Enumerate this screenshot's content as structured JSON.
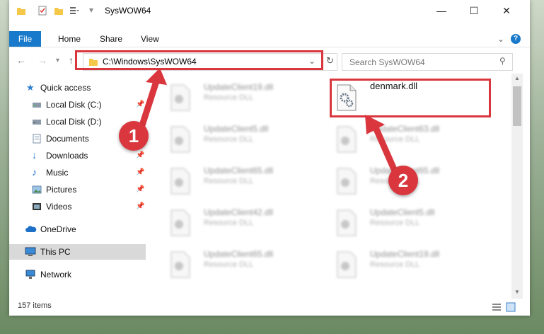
{
  "window": {
    "title": "SysWOW64",
    "minimize_glyph": "—",
    "maximize_glyph": "☐",
    "close_glyph": "✕"
  },
  "ribbon": {
    "file_label": "File",
    "tabs": [
      "Home",
      "Share",
      "View"
    ],
    "expand_glyph": "⌄",
    "help_glyph": "?"
  },
  "address": {
    "path": "C:\\Windows\\SysWOW64",
    "search_placeholder": "Search SysWOW64"
  },
  "nav": {
    "items": [
      {
        "label": "Quick access",
        "icon": "star-icon",
        "pinned": false
      },
      {
        "label": "Local Disk (C:)",
        "icon": "drive-icon",
        "pinned": true
      },
      {
        "label": "Local Disk (D:)",
        "icon": "drive-icon",
        "pinned": false
      },
      {
        "label": "Documents",
        "icon": "documents-icon",
        "pinned": true
      },
      {
        "label": "Downloads",
        "icon": "downloads-icon",
        "pinned": true
      },
      {
        "label": "Music",
        "icon": "music-icon",
        "pinned": true
      },
      {
        "label": "Pictures",
        "icon": "pictures-icon",
        "pinned": true
      },
      {
        "label": "Videos",
        "icon": "videos-icon",
        "pinned": true
      },
      {
        "label": "OneDrive",
        "icon": "cloud-icon",
        "pinned": false
      },
      {
        "label": "This PC",
        "icon": "computer-icon",
        "pinned": false
      },
      {
        "label": "Network",
        "icon": "network-icon",
        "pinned": false
      }
    ]
  },
  "files": {
    "left": [
      {
        "name": "UpdateClient19.dll",
        "type": "Resource DLL"
      },
      {
        "name": "UpdateClient5.dll",
        "type": "Resource DLL"
      },
      {
        "name": "UpdateClient65.dll",
        "type": "Resource DLL"
      },
      {
        "name": "UpdateClient42.dll",
        "type": "Resource DLL"
      },
      {
        "name": "UpdateClient65.dll",
        "type": "Resource DLL"
      }
    ],
    "right": [
      {
        "name": "denmark.dll",
        "type": ""
      },
      {
        "name": "UpdateClient63.dll",
        "type": "Resource DLL"
      },
      {
        "name": "UpdateClient65.dll",
        "type": "Resource DLL"
      },
      {
        "name": "UpdateClient5.dll",
        "type": "Resource DLL"
      },
      {
        "name": "UpdateClient19.dll",
        "type": "Resource DLL"
      }
    ]
  },
  "status": {
    "item_count": "157 items"
  },
  "annotations": {
    "step1": "1",
    "step2": "2"
  },
  "colors": {
    "accent": "#1979ca",
    "highlight": "#d9363e"
  }
}
